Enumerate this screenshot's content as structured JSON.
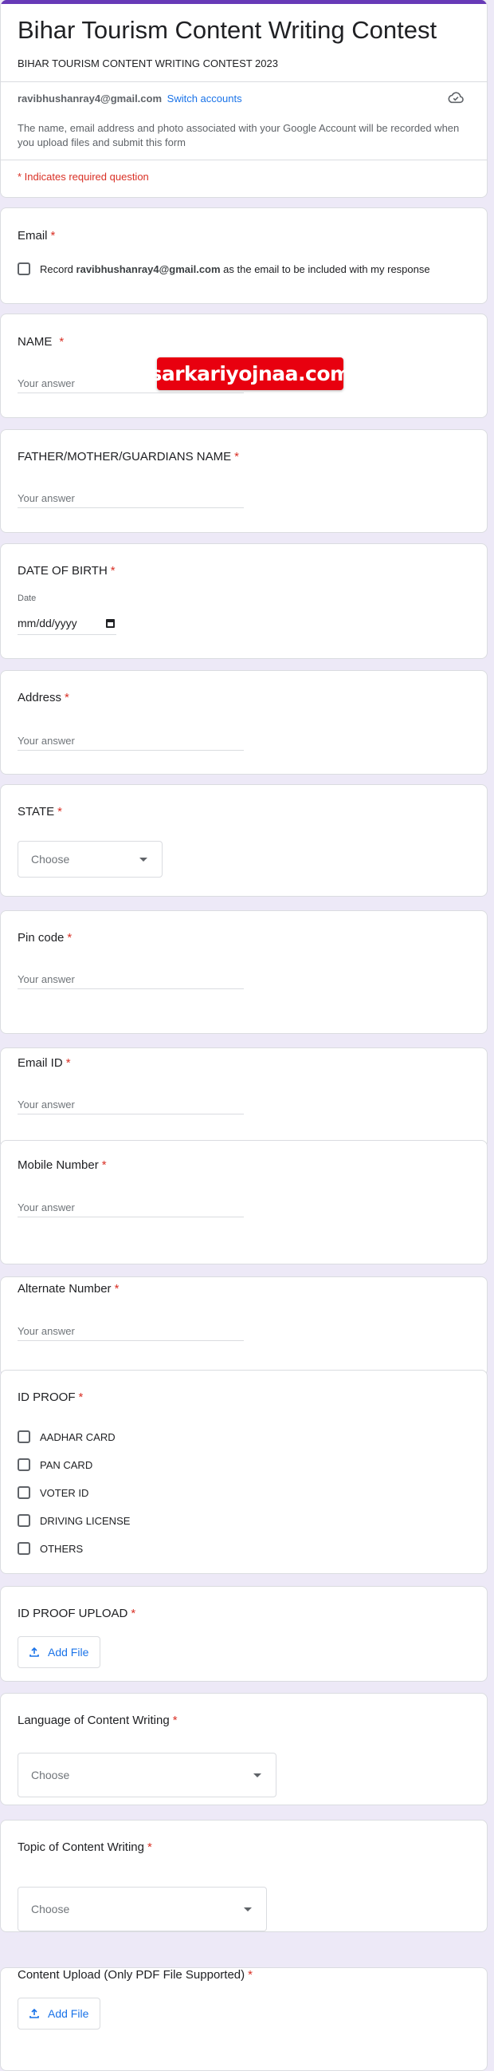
{
  "header": {
    "title": "Bihar Tourism Content Writing Contest",
    "subtitle": "BIHAR TOURISM CONTENT WRITING CONTEST 2023",
    "account_email": "ravibhushanray4@gmail.com",
    "switch_accounts": "Switch accounts",
    "cloud_icon": "cloud-done-icon",
    "notice": "The name, email address and photo associated with your Google Account will be recorded when you upload files and submit this form",
    "required_note": "* Indicates required question",
    "accent_color": "#673ab7"
  },
  "required_marker": "*",
  "email_question": {
    "title": "Email",
    "record_prefix": "Record ",
    "record_email": "ravibhushanray4@gmail.com",
    "record_suffix": " as the email to be included with my response"
  },
  "questions": {
    "name": {
      "title": "NAME",
      "placeholder": "Your answer"
    },
    "guardian": {
      "title": "FATHER/MOTHER/GUARDIANS NAME",
      "placeholder": "Your answer"
    },
    "dob": {
      "title": "DATE OF BIRTH",
      "date_label": "Date",
      "date_placeholder": "mm/dd/yyyy"
    },
    "address": {
      "title": "Address",
      "placeholder": "Your answer"
    },
    "state": {
      "title": "STATE",
      "selected": "Choose"
    },
    "pincode": {
      "title": "Pin code",
      "placeholder": "Your answer"
    },
    "email_id": {
      "title": "Email ID",
      "placeholder": "Your answer"
    },
    "mobile": {
      "title": "Mobile Number",
      "placeholder": "Your answer"
    },
    "alternate": {
      "title": "Alternate Number",
      "placeholder": "Your answer"
    },
    "id_proof": {
      "title": "ID PROOF",
      "options": [
        "AADHAR CARD",
        "PAN CARD",
        "VOTER ID",
        "DRIVING LICENSE",
        "OTHERS"
      ]
    },
    "id_upload": {
      "title": "ID PROOF UPLOAD",
      "button": "Add File"
    },
    "language": {
      "title": "Language of Content Writing",
      "selected": "Choose"
    },
    "topic": {
      "title": "Topic of Content Writing",
      "selected": "Choose"
    },
    "content_upload": {
      "title": "Content Upload (Only PDF File Supported)",
      "button": "Add File"
    }
  },
  "watermark": "sarkariyojnaa.com"
}
